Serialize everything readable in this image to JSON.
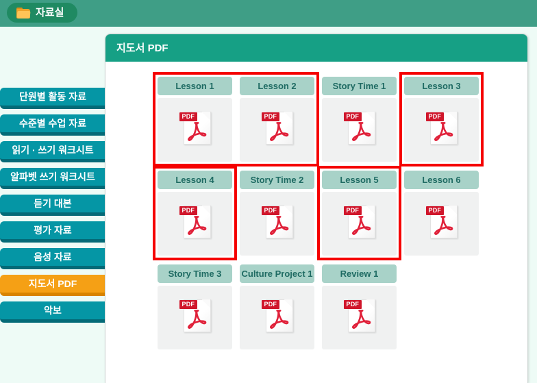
{
  "header": {
    "tab_label": "자료실",
    "folder_icon": "folder-icon",
    "bar_color": "#3f9e86",
    "tab_color": "#1f8a62"
  },
  "sidebar": {
    "items": [
      {
        "label": "단원별 활동 자료",
        "active": false
      },
      {
        "label": "수준별 수업 자료",
        "active": false
      },
      {
        "label": "읽기 · 쓰기 워크시트",
        "active": false
      },
      {
        "label": "알파벳 쓰기 워크시트",
        "active": false
      },
      {
        "label": "듣기 대본",
        "active": false
      },
      {
        "label": "평가 자료",
        "active": false
      },
      {
        "label": "음성 자료",
        "active": false
      },
      {
        "label": "지도서 PDF",
        "active": true
      },
      {
        "label": "악보",
        "active": false
      }
    ],
    "colors": {
      "normal": "#0596a5",
      "normal_shadow": "#046a77",
      "active": "#f5a015",
      "active_shadow": "#d88400"
    }
  },
  "panel": {
    "title": "지도서 PDF",
    "header_color": "#16a085",
    "body_color": "#ffffff"
  },
  "grid": {
    "card_label_color": "#a8d2c8",
    "card_label_text_color": "#1f6b63",
    "card_body_color": "#f0f1f1",
    "icon_name": "pdf-file-icon",
    "icon_badge_text": "PDF",
    "highlight_color": "#f50000",
    "rows": [
      {
        "cards": [
          {
            "label": "Lesson 1",
            "highlighted": true
          },
          {
            "label": "Lesson 2",
            "highlighted": true
          },
          {
            "label": "Story Time 1",
            "highlighted": false
          },
          {
            "label": "Lesson 3",
            "highlighted": true
          }
        ]
      },
      {
        "cards": [
          {
            "label": "Lesson 4",
            "highlighted": true
          },
          {
            "label": "Story Time 2",
            "highlighted": false
          },
          {
            "label": "Lesson 5",
            "highlighted": true
          },
          {
            "label": "Lesson 6",
            "highlighted": false
          }
        ]
      },
      {
        "cards": [
          {
            "label": "Story Time 3",
            "highlighted": false
          },
          {
            "label": "Culture Project 1",
            "highlighted": false
          },
          {
            "label": "Review 1",
            "highlighted": false
          }
        ]
      }
    ]
  }
}
